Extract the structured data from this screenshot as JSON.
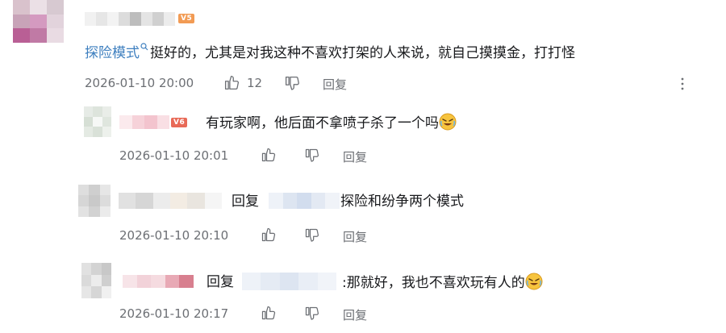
{
  "colors": {
    "link": "#3e7fbf",
    "meta": "#6c6f74",
    "badge_orange": "#f29b54",
    "badge_red": "#e86a57"
  },
  "main_comment": {
    "level": "V5",
    "link_text": "探险模式",
    "content": "挺好的，尤其是对我这种不喜欢打架的人来说，就自己摸摸金，打打怪",
    "time": "2026-01-10 20:00",
    "likes": "12",
    "reply_label": "回复"
  },
  "replies": [
    {
      "level": "V6",
      "content": "有玩家啊，他后面不拿喷子杀了一个吗",
      "time": "2026-01-10 20:01",
      "reply_label": "回复",
      "has_emoji": true
    },
    {
      "prefix": "回复",
      "content": "探险和纷争两个模式",
      "time": "2026-01-10 20:10",
      "reply_label": "回复"
    },
    {
      "prefix": "回复",
      "content": ":那就好，我也不喜欢玩有人的",
      "time": "2026-01-10 20:17",
      "reply_label": "回复",
      "has_emoji": true
    }
  ],
  "icons": {
    "like": "thumbs-up-icon",
    "dislike": "thumbs-down-icon",
    "more": "more-vertical-icon",
    "search": "search-icon",
    "emoji": "laughing-crying-emoji"
  }
}
